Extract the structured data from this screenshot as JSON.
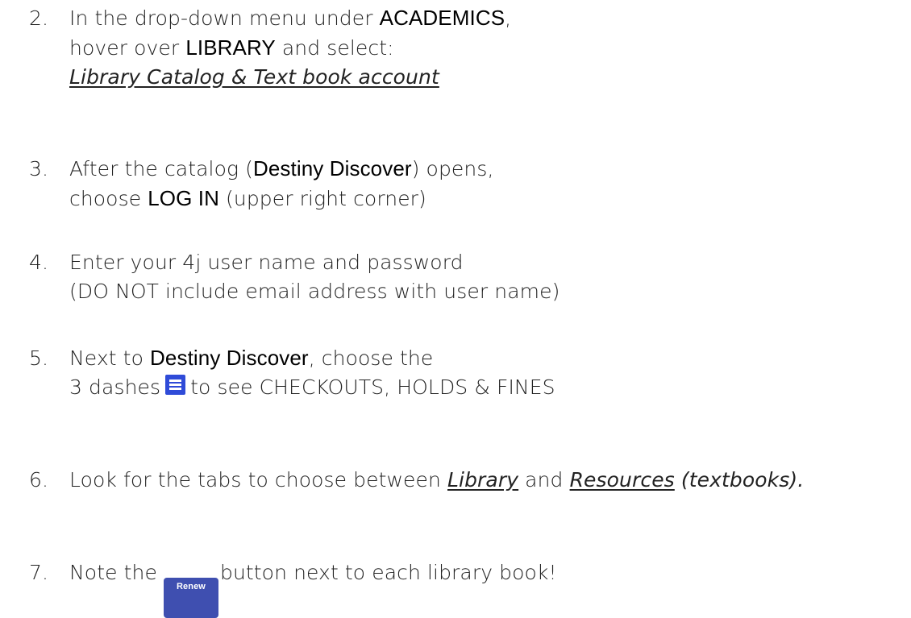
{
  "steps": [
    {
      "num": "2.",
      "lines": [
        {
          "a": "In the drop-down menu under ",
          "b": "ACADEMICS",
          "c": ","
        },
        {
          "a": "hover over ",
          "b": "LIBRARY",
          "c": " and select:"
        },
        {
          "link": "Library Catalog & Text book account"
        }
      ]
    },
    {
      "num": "3.",
      "lines": [
        {
          "a": "After the catalog (",
          "b": "Destiny Discover",
          "c": ") opens,"
        },
        {
          "a": "choose ",
          "b": "LOG IN",
          "c": " (upper right corner)"
        }
      ]
    },
    {
      "num": "4.",
      "lines": [
        {
          "a": "Enter your 4j user name and password"
        },
        {
          "a": "(DO NOT include email address with user name)"
        }
      ]
    },
    {
      "num": "5.",
      "lines": [
        {
          "a": "Next to ",
          "b": "Destiny Discover",
          "c": ", choose the"
        },
        {
          "a": "3 dashes",
          "c": "to see CHECKOUTS, HOLDS & FINES"
        }
      ]
    },
    {
      "num": "6.",
      "lines": [
        {
          "a": "Look for the tabs to choose between ",
          "link1": "Library",
          "mid": " and ",
          "link2": "Resources",
          "tail": " (textbooks)."
        }
      ]
    },
    {
      "num": "7.",
      "lines": [
        {
          "a": "Note the",
          "button": "Renew",
          "c": "button next to each library book!"
        }
      ]
    }
  ],
  "icons": {
    "menu": "hamburger-menu-icon"
  },
  "colors": {
    "menu_icon": "#2f4bd8",
    "renew_button": "#3f4fb0"
  }
}
